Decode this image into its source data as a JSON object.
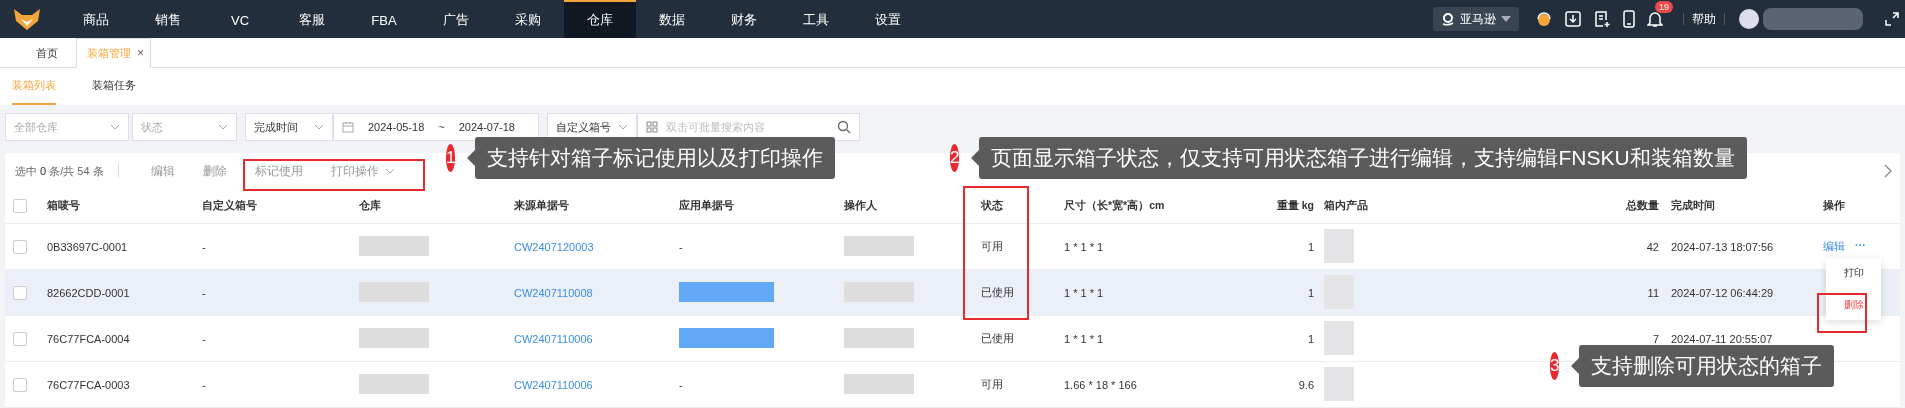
{
  "nav": {
    "items": [
      {
        "label": "商品",
        "selected": false
      },
      {
        "label": "销售",
        "selected": false
      },
      {
        "label": "VC",
        "selected": false
      },
      {
        "label": "客服",
        "selected": false
      },
      {
        "label": "FBA",
        "selected": false
      },
      {
        "label": "广告",
        "selected": false
      },
      {
        "label": "采购",
        "selected": false
      },
      {
        "label": "仓库",
        "selected": true
      },
      {
        "label": "数据",
        "selected": false
      },
      {
        "label": "财务",
        "selected": false
      },
      {
        "label": "工具",
        "selected": false
      },
      {
        "label": "设置",
        "selected": false
      }
    ],
    "marketplace": "亚马逊",
    "notification_count": "19",
    "help": "帮助"
  },
  "page_tabs": [
    {
      "label": "首页",
      "selected": false,
      "closable": false
    },
    {
      "label": "装箱管理",
      "selected": true,
      "closable": true
    }
  ],
  "close_glyph": "×",
  "sub_tabs": [
    {
      "label": "装箱列表",
      "selected": true
    },
    {
      "label": "装箱任务",
      "selected": false
    }
  ],
  "filters": {
    "warehouse": {
      "placeholder": "全部仓库"
    },
    "status": {
      "placeholder": "状态"
    },
    "date_type": "完成时间",
    "date_from": "2024-05-18",
    "date_sep": "~",
    "date_to": "2024-07-18",
    "search_type": "自定义箱号",
    "search": {
      "placeholder": "双击可批量搜索内容"
    }
  },
  "toolbar": {
    "selection_prefix": "选中 ",
    "selected_count": "0",
    "selection_suffix": " 条/共 54 条",
    "actions": [
      {
        "label": "编辑",
        "disabled": true,
        "dropdown": false
      },
      {
        "label": "删除",
        "disabled": true,
        "dropdown": false
      },
      {
        "label": "标记使用",
        "disabled": true,
        "dropdown": false
      },
      {
        "label": "打印操作",
        "disabled": true,
        "dropdown": true
      }
    ]
  },
  "table": {
    "header_checked": false,
    "columns": [
      "箱唛号",
      "自定义箱号",
      "仓库",
      "来源单据号",
      "应用单据号",
      "操作人",
      "状态",
      "尺寸（长*宽*高）cm",
      "重量 kg",
      "箱内产品",
      "总数量",
      "完成时间",
      "操作"
    ],
    "rows": [
      {
        "box_no": "0B33697C-0001",
        "custom_no": "-",
        "source_no": "CW2407120003",
        "applied_no": "-",
        "status": "可用",
        "size": "1 * 1 * 1",
        "weight": "1",
        "total": "42",
        "finished": "2024-07-13 18:07:56",
        "edit": "编辑",
        "more": "···",
        "highlighted": false,
        "checked": false
      },
      {
        "box_no": "82662CDD-0001",
        "custom_no": "-",
        "source_no": "CW2407110008",
        "status": "已使用",
        "size": "1 * 1 * 1",
        "weight": "1",
        "total": "11",
        "finished": "2024-07-12 06:44:29",
        "highlighted": true,
        "checked": false
      },
      {
        "box_no": "76C77FCA-0004",
        "custom_no": "-",
        "source_no": "CW2407110006",
        "status": "已使用",
        "size": "1 * 1 * 1",
        "weight": "1",
        "total": "7",
        "finished": "2024-07-11 20:55:07",
        "highlighted": false,
        "checked": false
      },
      {
        "box_no": "76C77FCA-0003",
        "custom_no": "-",
        "source_no": "CW2407110006",
        "applied_no": "-",
        "status": "可用",
        "size": "1.66 * 18 * 166",
        "weight": "9.6",
        "highlighted": false,
        "checked": false
      }
    ]
  },
  "menu": {
    "items": [
      {
        "label": "打印",
        "kind": "normal"
      },
      {
        "label": "删除",
        "kind": "danger"
      }
    ]
  },
  "callouts": [
    {
      "number": "1",
      "text": "支持针对箱子标记使用以及打印操作"
    },
    {
      "number": "2",
      "text": "页面显示箱子状态，仅支持可用状态箱子进行编辑，支持编辑FNSKU和装箱数量"
    },
    {
      "number": "3",
      "text": "支持删除可用状态的箱子"
    }
  ]
}
